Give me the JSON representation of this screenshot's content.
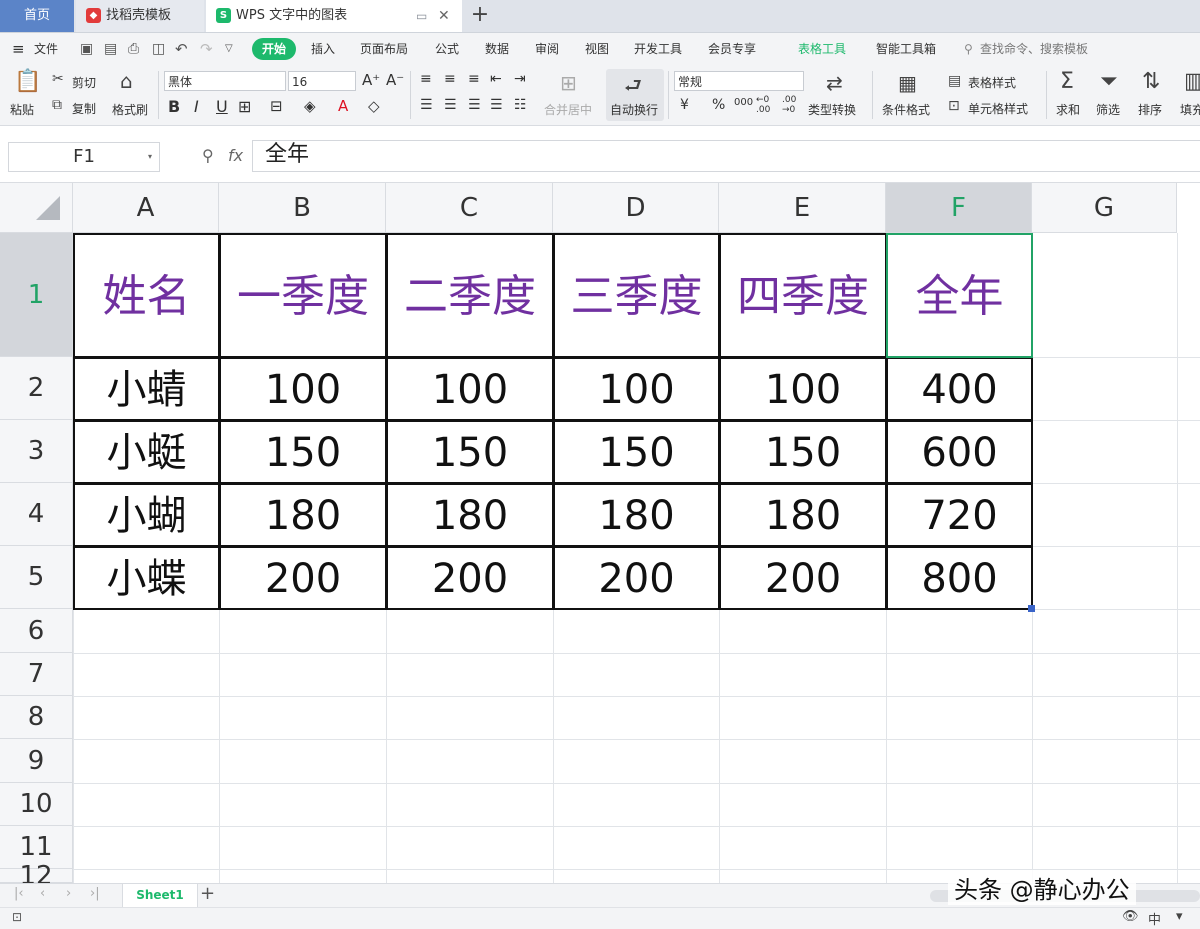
{
  "tabs": {
    "home": "首页",
    "template": "找稻壳模板",
    "doc": "WPS 文字中的图表"
  },
  "menu": {
    "file": "文件",
    "start": "开始",
    "insert": "插入",
    "page_layout": "页面布局",
    "formula": "公式",
    "data": "数据",
    "review": "审阅",
    "view": "视图",
    "developer": "开发工具",
    "member": "会员专享",
    "table_tools": "表格工具",
    "smart_toolbox": "智能工具箱",
    "search_placeholder": "查找命令、搜索模板"
  },
  "toolbar": {
    "paste": "粘贴",
    "cut": "剪切",
    "copy": "复制",
    "format_painter": "格式刷",
    "font_name": "黑体",
    "font_size": "16",
    "merge_center": "合并居中",
    "wrap_text": "自动换行",
    "number_format": "常规",
    "currency": "¥",
    "percent": "%",
    "thousands": "000",
    "inc_decimal": "←0 .00",
    "dec_decimal": ".00 →0",
    "type_convert": "类型转换",
    "conditional_format": "条件格式",
    "table_style": "表格样式",
    "cell_style": "单元格样式",
    "sum": "求和",
    "filter": "筛选",
    "sort": "排序",
    "fill": "填充"
  },
  "formula_bar": {
    "name_box": "F1",
    "fx": "fx",
    "content": "全年"
  },
  "columns": [
    "A",
    "B",
    "C",
    "D",
    "E",
    "F",
    "G"
  ],
  "rows": [
    "1",
    "2",
    "3",
    "4",
    "5",
    "6",
    "7",
    "8",
    "9",
    "10",
    "11",
    "12"
  ],
  "table": {
    "headers": [
      "姓名",
      "一季度",
      "二季度",
      "三季度",
      "四季度",
      "全年"
    ],
    "body": [
      [
        "小蜻",
        "100",
        "100",
        "100",
        "100",
        "400"
      ],
      [
        "小蜓",
        "150",
        "150",
        "150",
        "150",
        "600"
      ],
      [
        "小蝴",
        "180",
        "180",
        "180",
        "180",
        "720"
      ],
      [
        "小蝶",
        "200",
        "200",
        "200",
        "200",
        "800"
      ]
    ]
  },
  "sheet": {
    "tab": "Sheet1",
    "watermark": "头条 @静心办公"
  },
  "colors": {
    "header_text": "#7030a0",
    "accent_green": "#1db96c",
    "selection": "#21a366"
  }
}
